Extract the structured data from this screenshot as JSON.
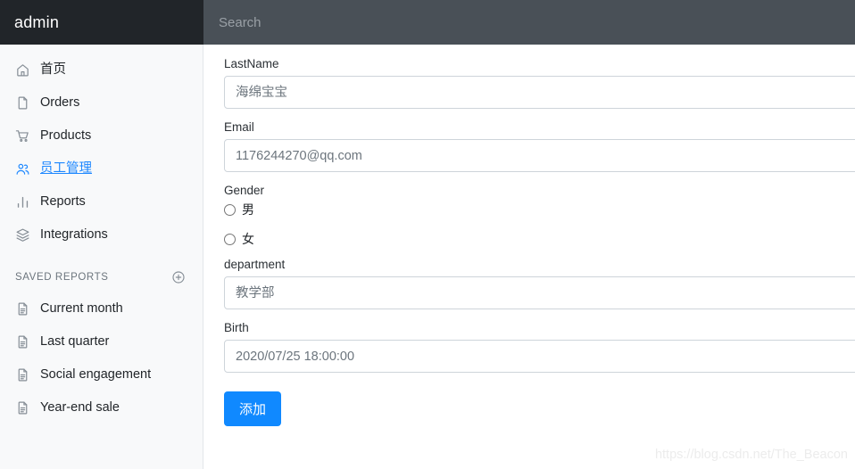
{
  "brand": {
    "title": "admin"
  },
  "topbar": {
    "search_placeholder": "Search",
    "search_value": ""
  },
  "sidebar": {
    "items": [
      {
        "label": "首页",
        "icon": "home-icon",
        "active": false
      },
      {
        "label": "Orders",
        "icon": "file-icon",
        "active": false
      },
      {
        "label": "Products",
        "icon": "cart-icon",
        "active": false
      },
      {
        "label": "员工管理",
        "icon": "users-icon",
        "active": true
      },
      {
        "label": "Reports",
        "icon": "bar-chart-icon",
        "active": false
      },
      {
        "label": "Integrations",
        "icon": "layers-icon",
        "active": false
      }
    ],
    "saved_reports": {
      "title": "SAVED REPORTS",
      "add_label": "+",
      "items": [
        {
          "label": "Current month",
          "icon": "document-icon"
        },
        {
          "label": "Last quarter",
          "icon": "document-icon"
        },
        {
          "label": "Social engagement",
          "icon": "document-icon"
        },
        {
          "label": "Year-end sale",
          "icon": "document-icon"
        }
      ]
    }
  },
  "form": {
    "lastname": {
      "label": "LastName",
      "value": "海绵宝宝",
      "placeholder": "海绵宝宝"
    },
    "email": {
      "label": "Email",
      "value": "1176244270@qq.com",
      "placeholder": "1176244270@qq.com"
    },
    "gender": {
      "label": "Gender",
      "options": [
        {
          "label": "男",
          "checked": false
        },
        {
          "label": "女",
          "checked": false
        }
      ]
    },
    "department": {
      "label": "department",
      "value": "教学部",
      "placeholder": "教学部"
    },
    "birth": {
      "label": "Birth",
      "value": "2020/07/25 18:00:00",
      "placeholder": "2020/07/25 18:00:00"
    },
    "submit": {
      "label": "添加"
    }
  },
  "watermark": {
    "text": "https://blog.csdn.net/The_Beacon"
  },
  "colors": {
    "brand_bg": "#212529",
    "topbar_bg": "#495057",
    "sidebar_bg": "#f8f9fa",
    "accent": "#1e88ff",
    "button": "#1089ff",
    "input_border": "#ced4da"
  }
}
